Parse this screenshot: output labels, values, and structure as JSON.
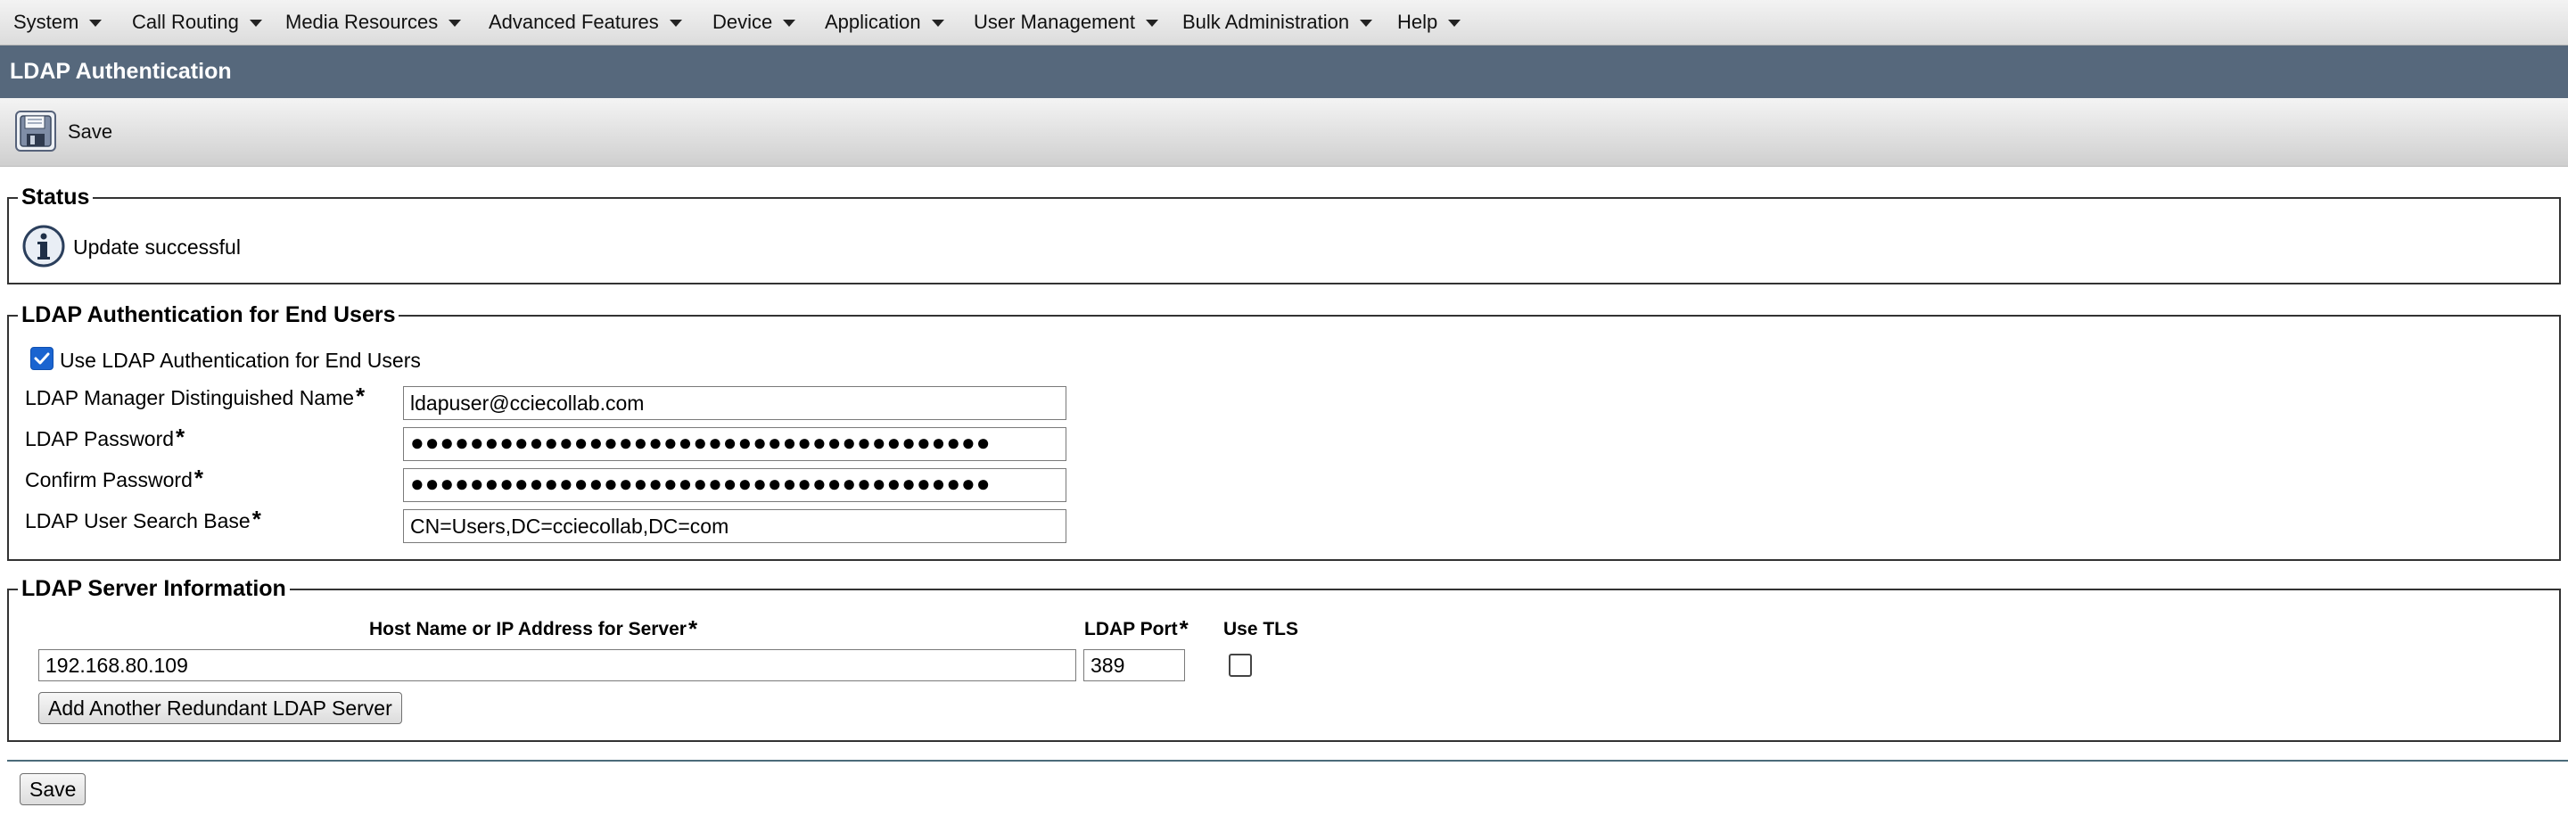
{
  "menu": {
    "items": [
      {
        "label": "System"
      },
      {
        "label": "Call Routing"
      },
      {
        "label": "Media Resources"
      },
      {
        "label": "Advanced Features"
      },
      {
        "label": "Device"
      },
      {
        "label": "Application"
      },
      {
        "label": "User Management"
      },
      {
        "label": "Bulk Administration"
      },
      {
        "label": "Help"
      }
    ]
  },
  "page": {
    "title": "LDAP Authentication"
  },
  "toolbar": {
    "save_label": "Save",
    "save_icon": "floppy-disk-icon"
  },
  "status": {
    "legend": "Status",
    "icon": "info-icon",
    "message": "Update successful"
  },
  "end_users": {
    "legend": "LDAP Authentication for End Users",
    "use_ldap_label": "Use LDAP Authentication for End Users",
    "use_ldap_checked": true,
    "manager_dn_label": "LDAP Manager Distinguished Name",
    "manager_dn_value": "ldapuser@cciecollab.com",
    "password_label": "LDAP Password",
    "password_value": "●●●●●●●●●●●●●●●●●●●●●●●●●●●●●●●●●●●●●●●",
    "confirm_label": "Confirm Password",
    "confirm_value": "●●●●●●●●●●●●●●●●●●●●●●●●●●●●●●●●●●●●●●●",
    "search_base_label": "LDAP User Search Base",
    "search_base_value": "CN=Users,DC=cciecollab,DC=com",
    "required_mark": "*"
  },
  "server": {
    "legend": "LDAP Server Information",
    "host_header": "Host Name or IP Address for Server",
    "port_header": "LDAP Port",
    "tls_header": "Use TLS",
    "host_value": "192.168.80.109",
    "port_value": "389",
    "use_tls_checked": false,
    "add_button_label": "Add Another Redundant LDAP Server",
    "required_mark": "*"
  },
  "footer": {
    "save_label": "Save"
  },
  "colors": {
    "title_bar": "#56687c",
    "checkbox_checked": "#1a64d0"
  }
}
